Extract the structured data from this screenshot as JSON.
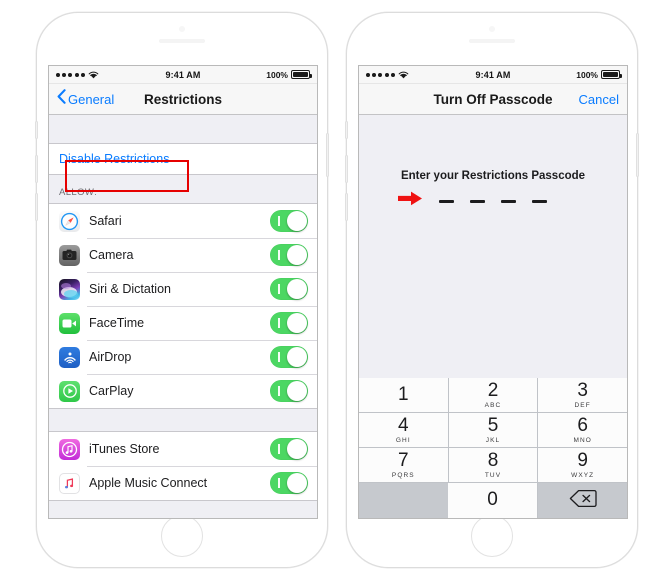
{
  "left_phone": {
    "status_bar": {
      "signal_dots": 5,
      "wifi_icon": "wifi-icon",
      "time": "9:41 AM",
      "battery_percent": "100%",
      "battery_icon": "battery-full-icon"
    },
    "nav": {
      "back_icon": "chevron-left-icon",
      "back_label": "General",
      "title": "Restrictions"
    },
    "disable_row": {
      "label": "Disable Restrictions",
      "highlight_color": "#e60000"
    },
    "allow_header": "ALLOW:",
    "allow_items": [
      {
        "label": "Safari",
        "icon": "safari-icon",
        "toggle": "on"
      },
      {
        "label": "Camera",
        "icon": "camera-icon",
        "toggle": "on"
      },
      {
        "label": "Siri & Dictation",
        "icon": "siri-icon",
        "toggle": "on"
      },
      {
        "label": "FaceTime",
        "icon": "facetime-icon",
        "toggle": "on"
      },
      {
        "label": "AirDrop",
        "icon": "airdrop-icon",
        "toggle": "on"
      },
      {
        "label": "CarPlay",
        "icon": "carplay-icon",
        "toggle": "on"
      }
    ],
    "store_items": [
      {
        "label": "iTunes Store",
        "icon": "itunes-store-icon",
        "toggle": "on"
      },
      {
        "label": "Apple Music Connect",
        "icon": "apple-music-connect-icon",
        "toggle": "on"
      }
    ]
  },
  "right_phone": {
    "status_bar": {
      "signal_dots": 5,
      "wifi_icon": "wifi-icon",
      "time": "9:41 AM",
      "battery_percent": "100%",
      "battery_icon": "battery-full-icon"
    },
    "nav": {
      "title": "Turn Off Passcode",
      "cancel_label": "Cancel"
    },
    "passcode": {
      "prompt": "Enter your Restrictions Passcode",
      "dash_count": 4,
      "entered_digits": 0,
      "arrow_icon": "red-arrow-right-icon",
      "arrow_color": "#e60000"
    },
    "keypad": [
      {
        "num": "1",
        "sub": ""
      },
      {
        "num": "2",
        "sub": "ABC"
      },
      {
        "num": "3",
        "sub": "DEF"
      },
      {
        "num": "4",
        "sub": "GHI"
      },
      {
        "num": "5",
        "sub": "JKL"
      },
      {
        "num": "6",
        "sub": "MNO"
      },
      {
        "num": "7",
        "sub": "PQRS"
      },
      {
        "num": "8",
        "sub": "TUV"
      },
      {
        "num": "9",
        "sub": "WXYZ"
      },
      {
        "num": "0",
        "sub": ""
      }
    ],
    "delete_icon": "delete-backspace-icon"
  },
  "theme": {
    "toggle_on_color": "#4cd763",
    "link_blue": "#0a7cff",
    "screen_bg": "#efeff4",
    "keypad_bg": "#c6c9ce"
  }
}
